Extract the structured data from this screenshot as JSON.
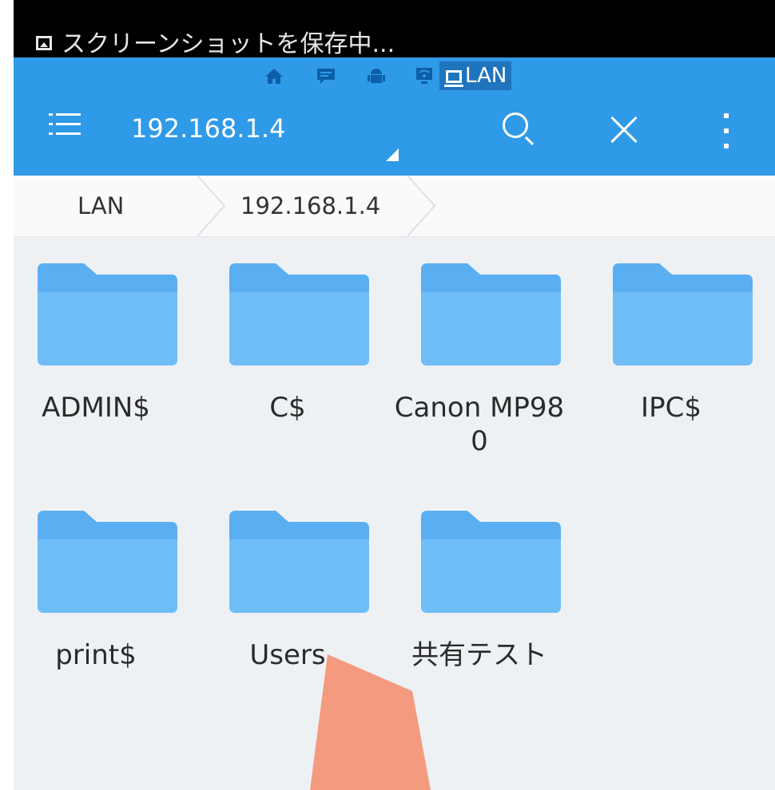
{
  "notification": {
    "icon": "image-icon",
    "text": "スクリーンショットを保存中..."
  },
  "toolbar": {
    "color": "#2f9ae8",
    "strip_icons": [
      "home-icon",
      "chat-icon",
      "android-icon",
      "wifi-icon"
    ],
    "strip_active_label": "LAN",
    "path": "192.168.1.4",
    "menu_icon": "hamburger-icon",
    "search_icon": "search-icon",
    "close_icon": "close-icon",
    "more_icon": "more-vert-icon"
  },
  "breadcrumb": {
    "items": [
      {
        "label": "LAN"
      },
      {
        "label": "192.168.1.4"
      }
    ]
  },
  "folders": [
    {
      "name": "ADMIN$"
    },
    {
      "name": "C$"
    },
    {
      "name": "Canon MP980"
    },
    {
      "name": "IPC$"
    },
    {
      "name": "print$"
    },
    {
      "name": "Users"
    },
    {
      "name": "共有テスト"
    }
  ],
  "colors": {
    "folder_back": "#5aaef2",
    "folder_front": "#6fbdf7",
    "background": "#eef1f4",
    "annotation_arrow": "#f49a7f"
  }
}
